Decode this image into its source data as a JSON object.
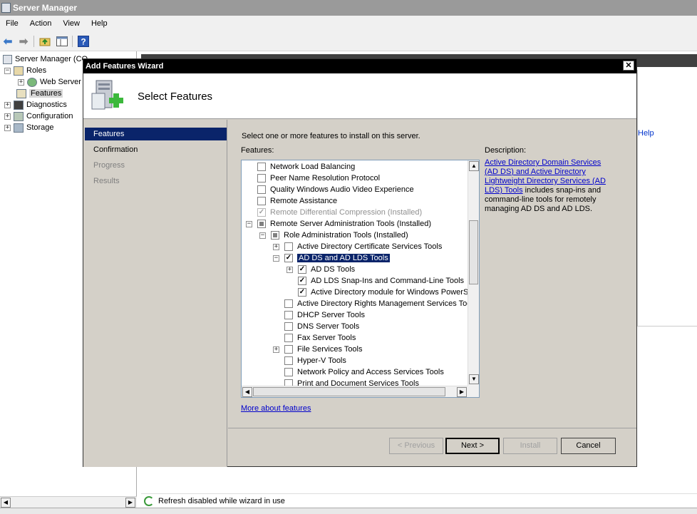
{
  "app": {
    "title": "Server Manager"
  },
  "menu": [
    "File",
    "Action",
    "View",
    "Help"
  ],
  "tree": {
    "root": "Server Manager (CO...",
    "roles": "Roles",
    "web_server": "Web Server",
    "features": "Features",
    "diagnostics": "Diagnostics",
    "configuration": "Configuration",
    "storage": "Storage"
  },
  "actions": {
    "help": "Help"
  },
  "status": {
    "text": "Refresh disabled while wizard in use"
  },
  "wizard": {
    "title": "Add Features Wizard",
    "close_label": "✕",
    "heading": "Select Features",
    "nav": [
      "Features",
      "Confirmation",
      "Progress",
      "Results"
    ],
    "instruction": "Select one or more features to install on this server.",
    "features_label": "Features:",
    "description_label": "Description:",
    "description_link": "Active Directory Domain Services (AD DS) and Active Directory Lightweight Directory Services (AD LDS) Tools",
    "description_rest": " includes snap-ins and command-line tools for remotely managing AD DS and AD LDS.",
    "features": [
      "Network Load Balancing",
      "Peer Name Resolution Protocol",
      "Quality Windows Audio Video Experience",
      "Remote Assistance",
      "Remote Differential Compression  (Installed)",
      "Remote Server Administration Tools  (Installed)",
      "Role Administration Tools  (Installed)",
      "Active Directory Certificate Services Tools",
      "AD DS and AD LDS Tools",
      "AD DS Tools",
      "AD LDS Snap-Ins and Command-Line Tools",
      "Active Directory module for Windows PowerShell",
      "Active Directory Rights Management Services Tools",
      "DHCP Server Tools",
      "DNS Server Tools",
      "Fax Server Tools",
      "File Services Tools",
      "Hyper-V Tools",
      "Network Policy and Access Services Tools",
      "Print and Document Services Tools"
    ],
    "more_link": "More about features",
    "buttons": {
      "previous": "< Previous",
      "next": "Next >",
      "install": "Install",
      "cancel": "Cancel"
    }
  }
}
